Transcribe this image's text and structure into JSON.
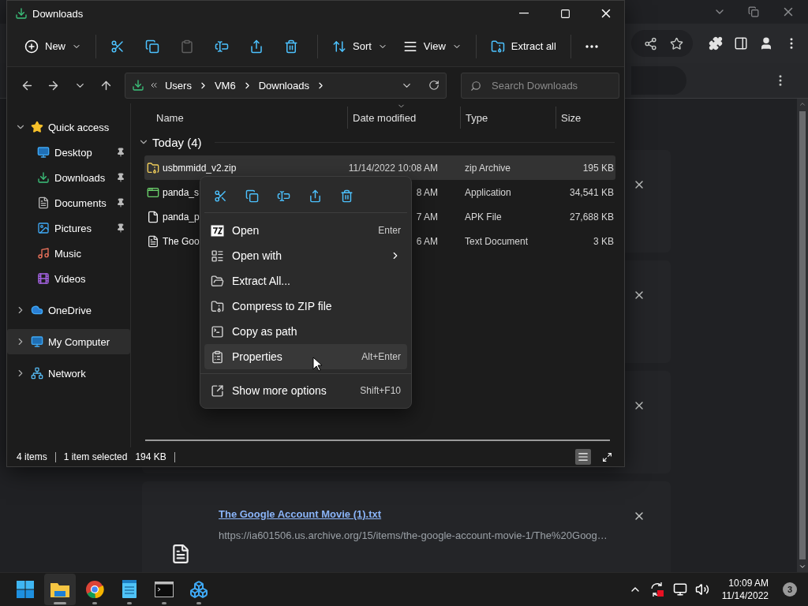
{
  "chrome": {
    "downloads": [
      {
        "kind": "covered"
      },
      {
        "kind": "covered"
      },
      {
        "kind": "covered"
      },
      {
        "kind": "file",
        "name": "The Google Account Movie (1).txt",
        "url": "https://ia601506.us.archive.org/15/items/the-google-account-movie-1/The%20Goog…"
      }
    ]
  },
  "explorer": {
    "title": "Downloads",
    "toolbar": [
      {
        "kind": "new",
        "label": "New",
        "disabled": false
      },
      {
        "kind": "cut",
        "disabled": false
      },
      {
        "kind": "copy",
        "disabled": false
      },
      {
        "kind": "paste",
        "disabled": true
      },
      {
        "kind": "rename",
        "disabled": false
      },
      {
        "kind": "share",
        "disabled": false
      },
      {
        "kind": "delete",
        "disabled": false
      },
      {
        "kind": "sort",
        "label": "Sort",
        "disabled": false
      },
      {
        "kind": "view",
        "label": "View",
        "disabled": false
      },
      {
        "kind": "extract",
        "label": "Extract all",
        "disabled": false
      },
      {
        "kind": "more",
        "disabled": false
      }
    ],
    "address": {
      "path": [
        "Users",
        "VM6",
        "Downloads"
      ]
    },
    "search": {
      "placeholder": "Search Downloads"
    },
    "sidebar": [
      {
        "kind": "quick-access",
        "label": "Quick access",
        "expanded": true,
        "selected": false,
        "children": [
          {
            "kind": "desktop",
            "label": "Desktop",
            "pinned": true,
            "selected": false
          },
          {
            "kind": "downloads",
            "label": "Downloads",
            "pinned": true,
            "selected": false
          },
          {
            "kind": "documents",
            "label": "Documents",
            "pinned": true,
            "selected": false
          },
          {
            "kind": "pictures",
            "label": "Pictures",
            "pinned": true,
            "selected": false
          },
          {
            "kind": "music",
            "label": "Music",
            "pinned": false,
            "selected": false
          },
          {
            "kind": "videos",
            "label": "Videos",
            "pinned": false,
            "selected": false
          }
        ]
      },
      {
        "kind": "onedrive",
        "label": "OneDrive",
        "expanded": false,
        "selected": false
      },
      {
        "kind": "computer",
        "label": "My Computer",
        "expanded": false,
        "selected": true
      },
      {
        "kind": "network",
        "label": "Network",
        "expanded": false,
        "selected": false
      }
    ],
    "columns": [
      {
        "label": "Name",
        "sorted": false
      },
      {
        "label": "Date modified",
        "sorted": true
      },
      {
        "label": "Type",
        "sorted": false
      },
      {
        "label": "Size",
        "sorted": false
      }
    ],
    "group": {
      "label": "Today (4)",
      "expanded": true
    },
    "rows": [
      {
        "kind": "zip",
        "name": "usbmmidd_v2.zip",
        "date": "11/14/2022 10:08 AM",
        "type": "zip Archive",
        "size": "195 KB",
        "selected": true
      },
      {
        "kind": "app",
        "name": "panda_s",
        "date": "8 AM",
        "type": "Application",
        "size": "34,541 KB",
        "selected": false
      },
      {
        "kind": "file",
        "name": "panda_p",
        "date": "7 AM",
        "type": "APK File",
        "size": "27,688 KB",
        "selected": false
      },
      {
        "kind": "text",
        "name": "The Goo",
        "date": "6 AM",
        "type": "Text Document",
        "size": "3 KB",
        "selected": false
      }
    ],
    "status": {
      "count": "4 items",
      "selection": "1 item selected",
      "size": "194 KB"
    },
    "views": [
      {
        "kind": "details",
        "selected": true
      },
      {
        "kind": "tiles",
        "selected": false
      }
    ]
  },
  "context_menu": {
    "items": [
      {
        "kind": "open",
        "label": "Open",
        "shortcut": "Enter",
        "hovered": false
      },
      {
        "kind": "open-with",
        "label": "Open with",
        "submenu": true,
        "hovered": false
      },
      {
        "kind": "extract",
        "label": "Extract All...",
        "hovered": false
      },
      {
        "kind": "compress",
        "label": "Compress to ZIP file",
        "hovered": false
      },
      {
        "kind": "copy-path",
        "label": "Copy as path",
        "hovered": false
      },
      {
        "kind": "properties",
        "label": "Properties",
        "shortcut": "Alt+Enter",
        "hovered": true
      },
      {
        "kind": "more-options",
        "label": "Show more options",
        "shortcut": "Shift+F10",
        "hovered": false
      }
    ]
  },
  "taskbar": {
    "apps": [
      {
        "kind": "explorer",
        "selected": true
      },
      {
        "kind": "chrome",
        "selected": false
      },
      {
        "kind": "notepad",
        "selected": false
      },
      {
        "kind": "terminal",
        "selected": false
      },
      {
        "kind": "app",
        "selected": false
      }
    ],
    "time": "10:09 AM",
    "date": "11/14/2022",
    "notifications": "3"
  }
}
